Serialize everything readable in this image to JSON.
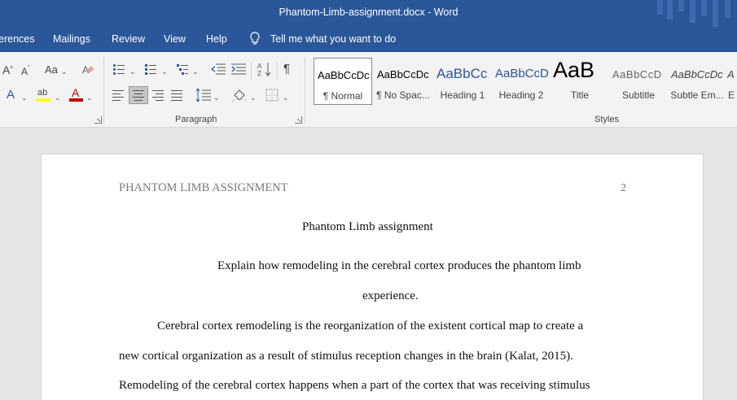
{
  "window": {
    "title": "Phantom-Limb-assignment.docx  -  Word"
  },
  "ribbon_tabs": [
    {
      "label": "erences"
    },
    {
      "label": "Mailings"
    },
    {
      "label": "Review"
    },
    {
      "label": "View"
    },
    {
      "label": "Help"
    }
  ],
  "tell_me": {
    "text": "Tell me what you want to do",
    "icon": "lightbulb-icon"
  },
  "font_group": {
    "grow_font": "A",
    "shrink_font": "A",
    "change_case": "Aa",
    "text_effects": "A",
    "highlight_color": "#ffff00",
    "font_color": "#c00000"
  },
  "paragraph_group": {
    "label": "Paragraph",
    "show_marks": "¶"
  },
  "styles_group": {
    "label": "Styles",
    "items": [
      {
        "sample": "AaBbCcDc",
        "name": "¶ Normal"
      },
      {
        "sample": "AaBbCcDc",
        "name": "¶ No Spac..."
      },
      {
        "sample": "AaBbCc",
        "name": "Heading 1"
      },
      {
        "sample": "AaBbCcD",
        "name": "Heading 2"
      },
      {
        "sample": "AaB",
        "name": "Title"
      },
      {
        "sample": "AaBbCcD",
        "name": "Subtitle"
      },
      {
        "sample": "AaBbCcDc",
        "name": "Subtle Em..."
      },
      {
        "sample": "A",
        "name": "E"
      }
    ]
  },
  "document": {
    "header_text": "PHANTOM LIMB ASSIGNMENT",
    "page_number": "2",
    "title": "Phantom Limb assignment",
    "question_line1": "Explain how remodeling in the cerebral cortex produces the phantom limb",
    "question_line2": "experience.",
    "body_line1": "Cerebral cortex remodeling is the reorganization of the existent cortical map to create a",
    "body_line2": "new cortical organization as a result of stimulus reception changes in the brain (Kalat, 2015).",
    "body_line3": "Remodeling of the cerebral cortex happens when a part of the cortex that was receiving stimulus"
  }
}
